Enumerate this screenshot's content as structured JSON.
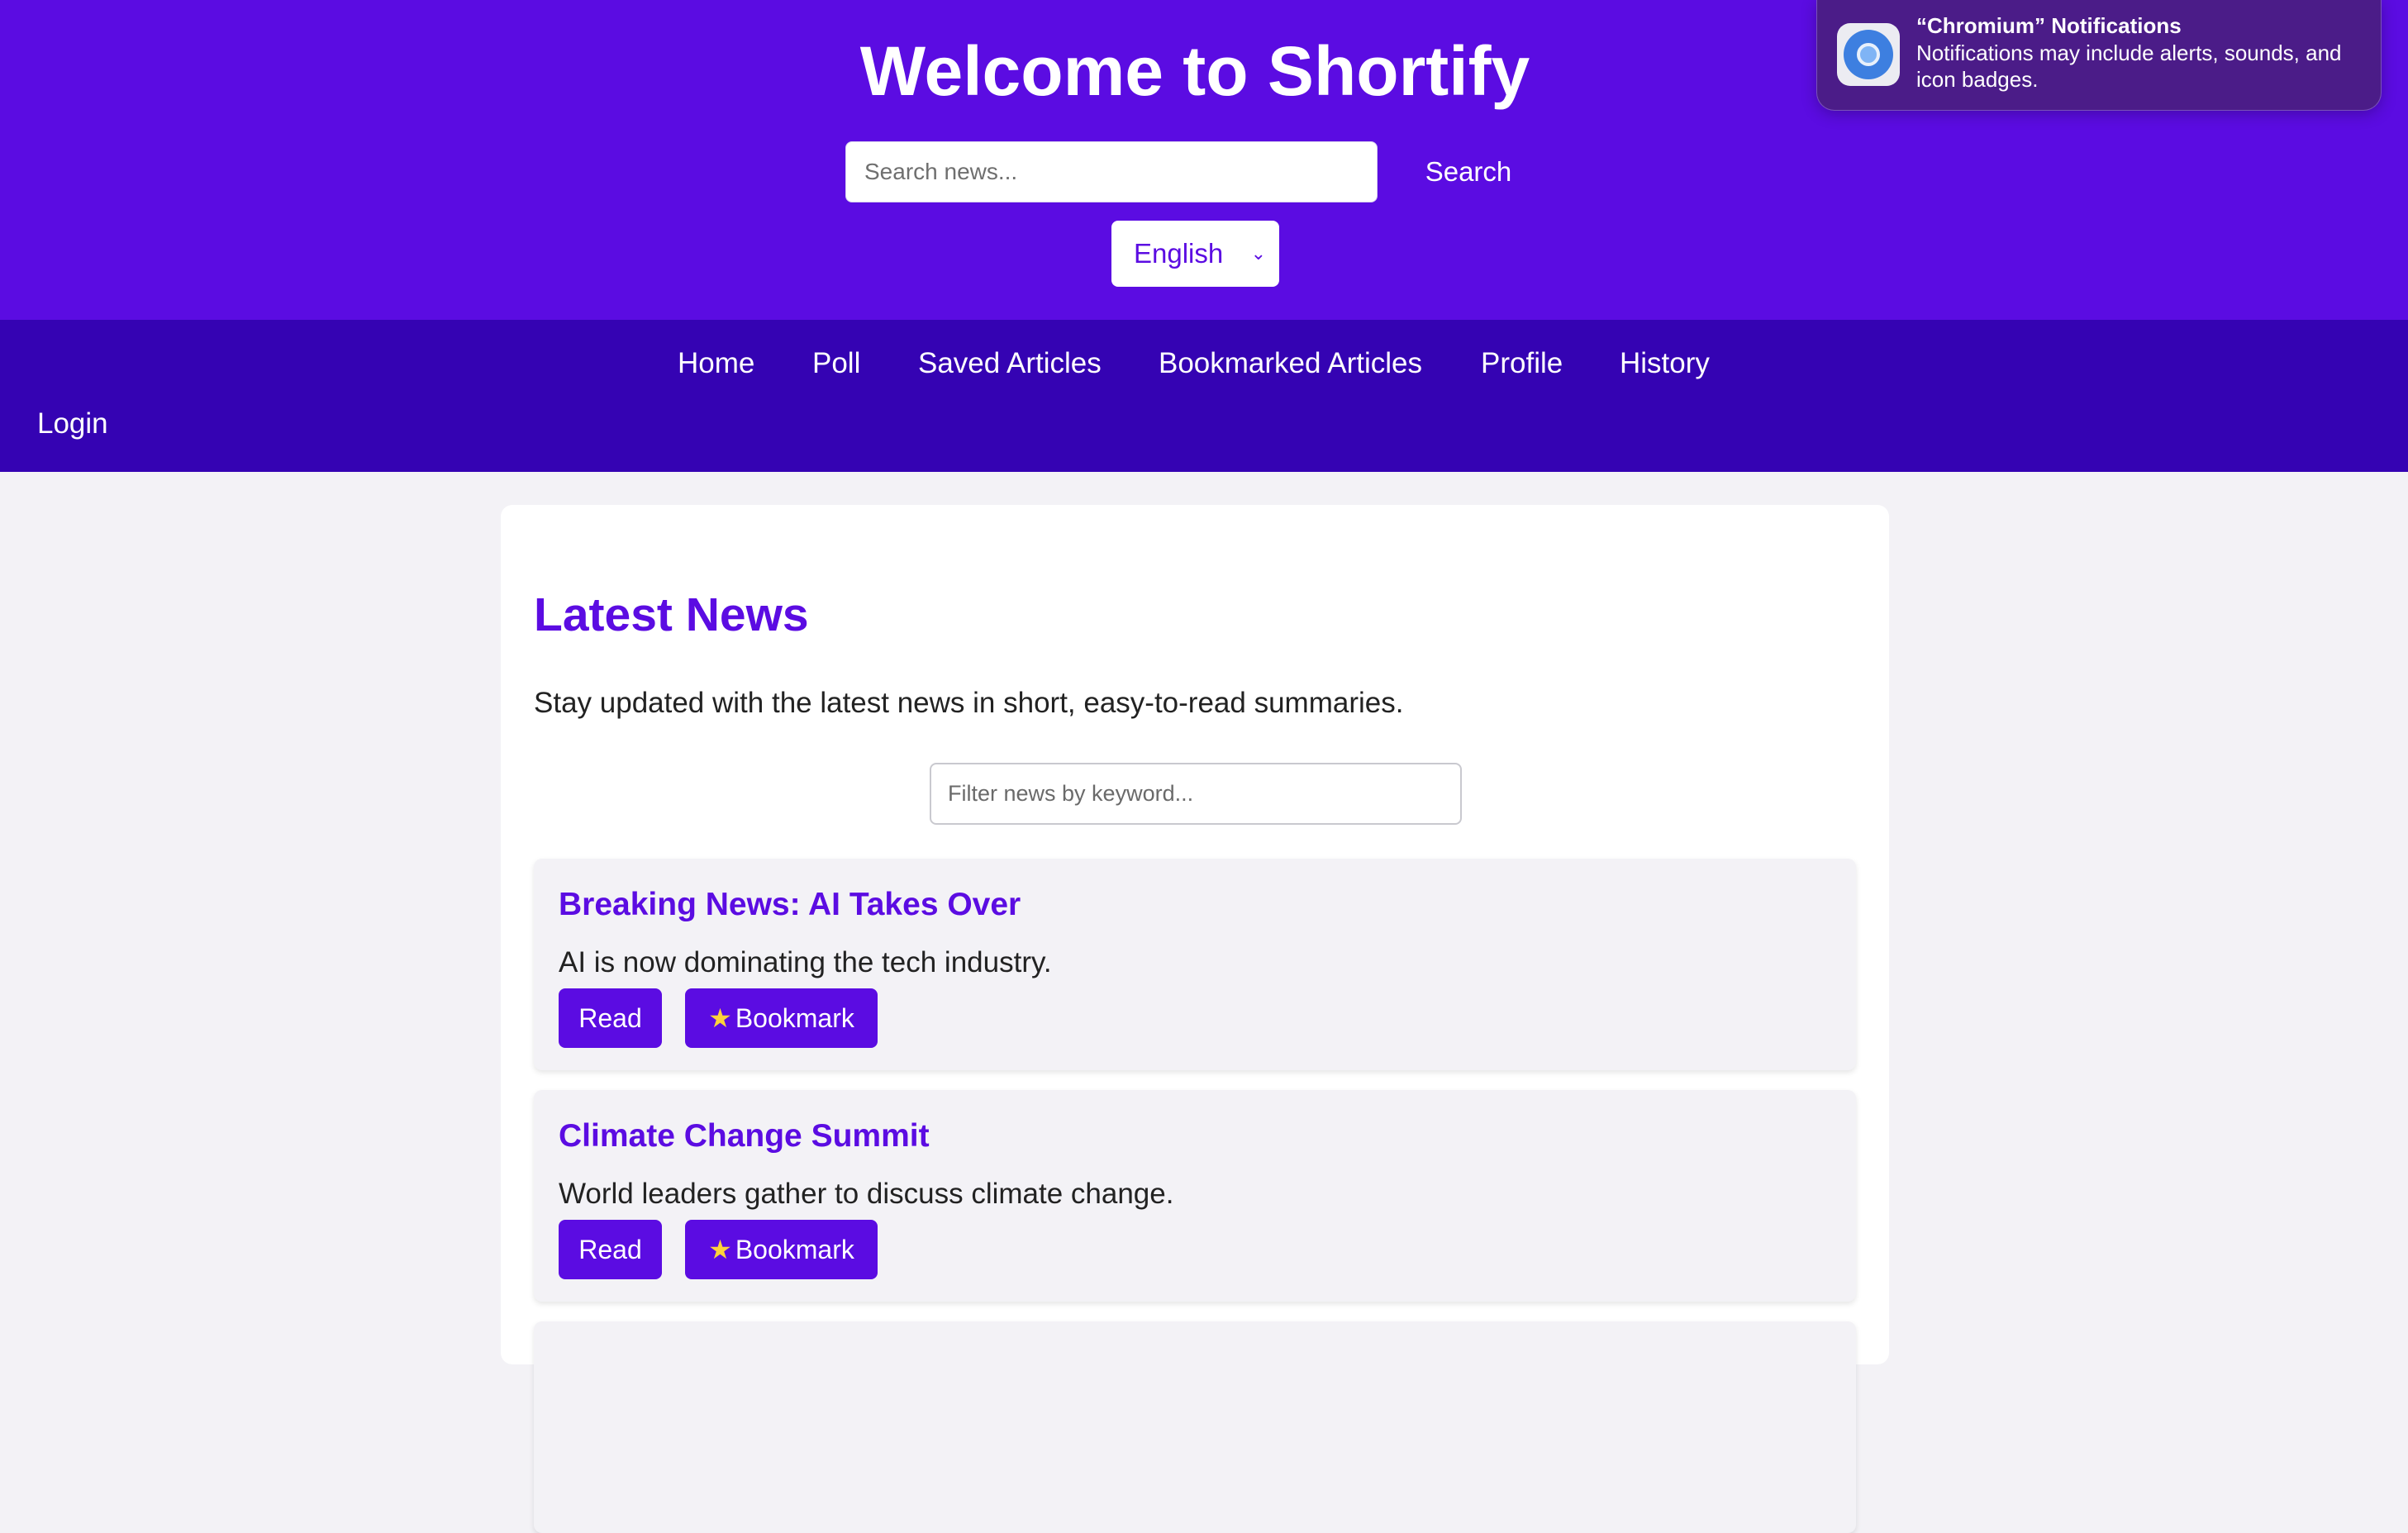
{
  "header": {
    "title": "Welcome to Shortify",
    "search_placeholder": "Search news...",
    "search_button": "Search",
    "language": "English"
  },
  "nav": {
    "items": [
      {
        "label": "Home"
      },
      {
        "label": "Poll"
      },
      {
        "label": "Saved Articles"
      },
      {
        "label": "Bookmarked Articles"
      },
      {
        "label": "Profile"
      },
      {
        "label": "History"
      },
      {
        "label": "Login"
      }
    ]
  },
  "notification": {
    "title": "“Chromium” Notifications",
    "body": "Notifications may include alerts, sounds, and icon badges.",
    "icon": "chromium-icon"
  },
  "main": {
    "title": "Latest News",
    "description": "Stay updated with the latest news in short, easy-to-read summaries.",
    "filter_placeholder": "Filter news by keyword...",
    "articles": [
      {
        "title": "Breaking News: AI Takes Over",
        "summary": "AI is now dominating the tech industry.",
        "read_label": "Read",
        "bookmark_label": "Bookmark"
      },
      {
        "title": "Climate Change Summit",
        "summary": "World leaders gather to discuss climate change.",
        "read_label": "Read",
        "bookmark_label": "Bookmark"
      },
      {
        "title": "",
        "summary": "",
        "read_label": "",
        "bookmark_label": ""
      }
    ]
  },
  "colors": {
    "accent": "#5b0ce2",
    "nav_background": "#3503b3",
    "page_background": "#f3f2f6",
    "notification_background": "#4b1c88"
  }
}
